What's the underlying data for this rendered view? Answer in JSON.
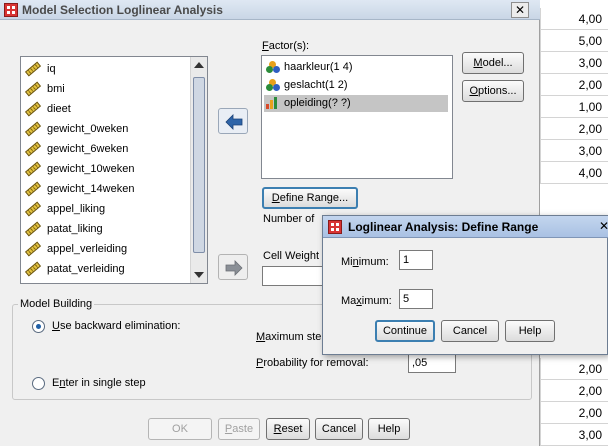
{
  "sheet": {
    "top_values": [
      "4,00",
      "5,00",
      "3,00",
      "2,00",
      "1,00",
      "2,00",
      "3,00",
      "4,00"
    ],
    "bottom_values": [
      "2,00",
      "2,00",
      "2,00",
      "3,00"
    ]
  },
  "dialog": {
    "title": "Model Selection Loglinear Analysis",
    "close_label": "✕",
    "variables": [
      "iq",
      "bmi",
      "dieet",
      "gewicht_0weken",
      "gewicht_6weken",
      "gewicht_10weken",
      "gewicht_14weken",
      "appel_liking",
      "patat_liking",
      "appel_verleiding",
      "patat_verleiding"
    ],
    "factors_label_prefix": "",
    "factors_label_ul": "F",
    "factors_label_rest": "actor(s):",
    "factors": [
      {
        "label": "haarkleur(1 4)",
        "icon": "nominal-icon"
      },
      {
        "label": "geslacht(1 2)",
        "icon": "nominal-icon"
      },
      {
        "label": "opleiding(? ?)",
        "icon": "ordinal-icon"
      }
    ],
    "model_ul": "M",
    "model_rest": "odel...",
    "options_ul": "O",
    "options_rest": "ptions...",
    "define_range_pre": "",
    "define_range_ul": "D",
    "define_range_rest": "efine Range...",
    "number_of_label": "Number of",
    "cell_weights_label": "Cell Weight",
    "model_building_title": "Model Building",
    "backward_ul": "U",
    "backward_rest": "se backward elimination:",
    "single_step_pre": "E",
    "single_step_ul": "n",
    "single_step_rest": "ter in single step",
    "max_steps_pre": "",
    "max_steps_ul": "M",
    "max_steps_rest": "aximum ste",
    "prob_removal_ul": "P",
    "prob_removal_rest": "robability for removal:",
    "prob_removal_value": ",05",
    "ok_label": "OK",
    "paste_ul": "P",
    "paste_rest": "aste",
    "reset_ul": "R",
    "reset_rest": "eset",
    "cancel_label": "Cancel",
    "help_label": "Help"
  },
  "define_range": {
    "title": "Loglinear Analysis: Define Range",
    "close_label": "✕",
    "minimum_pre": "Mi",
    "minimum_ul": "n",
    "minimum_rest": "imum:",
    "minimum_value": "1",
    "maximum_pre": "Ma",
    "maximum_ul": "x",
    "maximum_rest": "imum:",
    "maximum_value": "5",
    "continue_label": "Continue",
    "cancel_label": "Cancel",
    "help_label": "Help"
  },
  "colors": {
    "accent": "#3c7fb1",
    "selection": "#c5c5c5",
    "title_icon": "#d83434"
  }
}
